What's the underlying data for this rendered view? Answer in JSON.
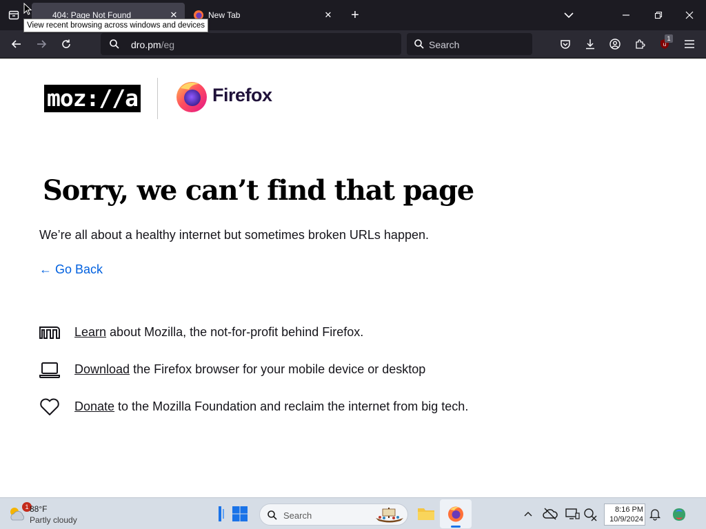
{
  "browser": {
    "tabs": [
      {
        "title": "404: Page Not Found",
        "active": true
      },
      {
        "title": "New Tab",
        "active": false
      }
    ],
    "tooltip": "View recent browsing across windows and devices",
    "url": {
      "domain": "dro.pm",
      "path": "/eg"
    },
    "search_placeholder": "Search",
    "extension_badge": "1",
    "accent_color": "#0060df"
  },
  "page": {
    "logo_text": "moz://a",
    "firefox_wordmark": "Firefox",
    "headline": "Sorry, we can’t find that page",
    "subtext": "We’re all about a healthy internet but sometimes broken URLs happen.",
    "go_back": "← Go Back",
    "links": [
      {
        "icon": "mozilla-m-icon",
        "link": "Learn",
        "rest": " about Mozilla, the not-for-profit behind Firefox."
      },
      {
        "icon": "laptop-icon",
        "link": "Download",
        "rest": " the Firefox browser for your mobile device or desktop"
      },
      {
        "icon": "heart-icon",
        "link": "Donate",
        "rest": " to the Mozilla Foundation and reclaim the internet from big tech."
      }
    ]
  },
  "taskbar": {
    "weather_temp": "88°F",
    "weather_condition": "Partly cloudy",
    "weather_badge": "1",
    "search_placeholder": "Search",
    "time": "8:16 PM",
    "date": "10/9/2024"
  }
}
